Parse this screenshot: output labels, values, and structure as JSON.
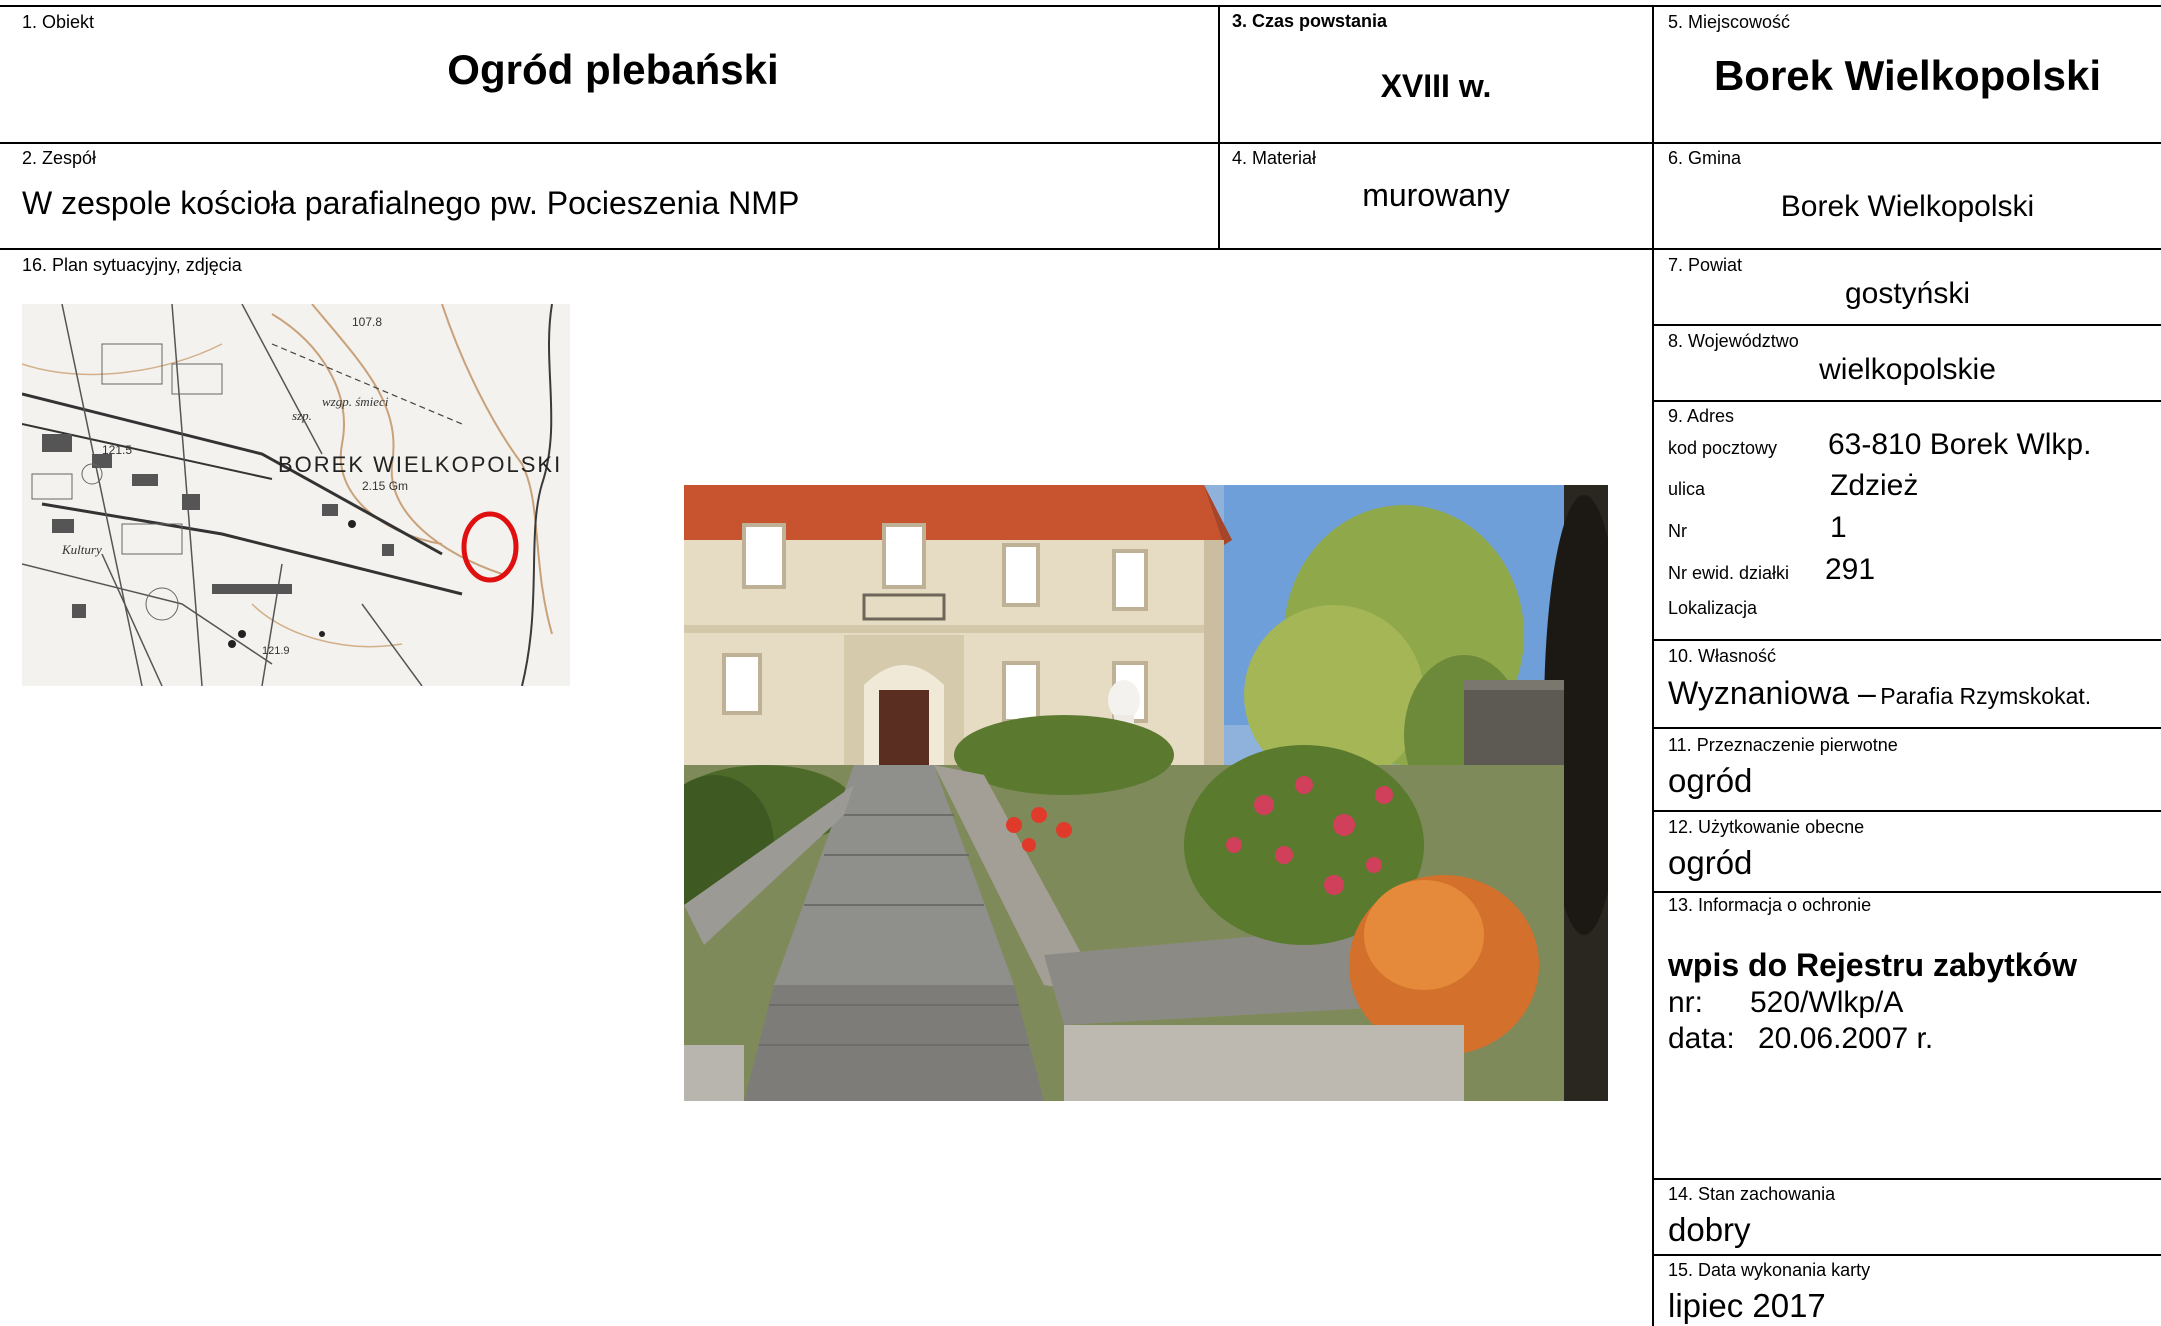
{
  "fields": {
    "obiekt": {
      "label": "1. Obiekt",
      "value": "Ogród plebański"
    },
    "zespol": {
      "label": "2. Zespół",
      "value": "W zespole kościoła parafialnego pw. Pocieszenia NMP"
    },
    "czas": {
      "label": "3. Czas powstania",
      "value": "XVIII w."
    },
    "material": {
      "label": "4. Materiał",
      "value": "murowany"
    },
    "miejscowosc": {
      "label": "5. Miejscowość",
      "value": "Borek Wielkopolski"
    },
    "gmina": {
      "label": "6. Gmina",
      "value": "Borek Wielkopolski"
    },
    "powiat": {
      "label": "7. Powiat",
      "value": "gostyński"
    },
    "wojewodztwo": {
      "label": "8. Województwo",
      "value": "wielkopolskie"
    },
    "adres": {
      "label": "9. Adres",
      "kod_label": "kod pocztowy",
      "kod_value": "63-810 Borek Wlkp.",
      "ulica_label": "ulica",
      "ulica_value": "Zdzież",
      "nr_label": "Nr",
      "nr_value": "1",
      "dzialka_label": "Nr ewid. działki",
      "dzialka_value": "291",
      "lokalizacja_label": "Lokalizacja"
    },
    "wlasnosc": {
      "label": "10. Własność",
      "value_main": "Wyznaniowa –",
      "value_small": "Parafia Rzymskokat."
    },
    "przeznaczenie": {
      "label": "11. Przeznaczenie pierwotne",
      "value": "ogród"
    },
    "uzytkowanie": {
      "label": "12. Użytkowanie obecne",
      "value": "ogród"
    },
    "ochrona": {
      "label": "13. Informacja o ochronie",
      "heading": "wpis do Rejestru zabytków",
      "nr_label": "nr:",
      "nr_value": "520/Wlkp/A",
      "data_label": "data:",
      "data_value": "20.06.2007 r."
    },
    "stan": {
      "label": "14. Stan zachowania",
      "value": "dobry"
    },
    "data_karty": {
      "label": "15. Data wykonania karty",
      "value": "lipiec  2017"
    },
    "plan": {
      "label": "16. Plan sytuacyjny, zdjęcia"
    }
  },
  "map": {
    "town_label": "BOREK WIELKOPOLSKI",
    "marker_color": "#e01010",
    "scale_text": "2.15 Gm"
  },
  "colors": {
    "border": "#000000",
    "text": "#000000",
    "roof": "#c8532f",
    "facade": "#e6dcc4"
  }
}
